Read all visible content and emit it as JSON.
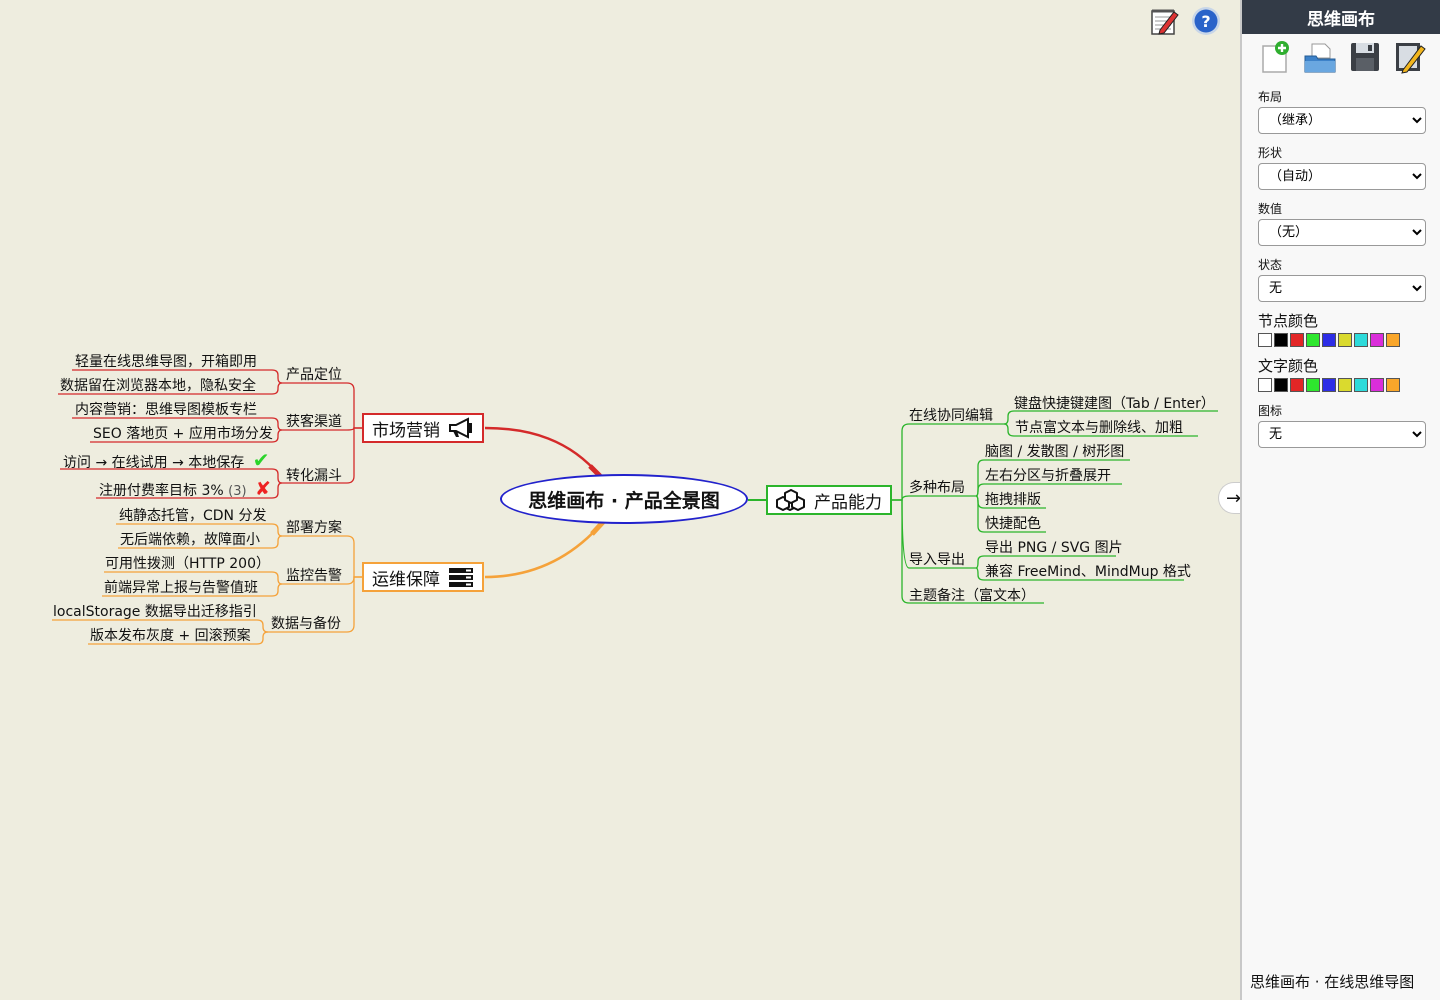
{
  "toolbar": {
    "edit_icon": "notepad-pencil-icon",
    "help_icon": "help-icon"
  },
  "map": {
    "root": "思维画布 · 产品全景图",
    "branches": {
      "marketing": {
        "label": "市场营销",
        "icon": "megaphone-icon",
        "color": "#d42a2a",
        "groups": [
          {
            "label": "产品定位",
            "items": [
              "轻量在线思维导图，开箱即用",
              "数据留在浏览器本地，隐私安全"
            ]
          },
          {
            "label": "获客渠道",
            "items": [
              "内容营销：思维导图模板专栏",
              "SEO 落地页 + 应用市场分发"
            ]
          },
          {
            "label": "转化漏斗",
            "items": [
              "访问 → 在线试用 → 本地保存",
              "注册付费率目标 3%"
            ],
            "count": "(3)"
          }
        ]
      },
      "ops": {
        "label": "运维保障",
        "icon": "server-icon",
        "color": "#f5a23a",
        "groups": [
          {
            "label": "部署方案",
            "items": [
              "纯静态托管，CDN 分发",
              "无后端依赖，故障面小"
            ]
          },
          {
            "label": "监控告警",
            "items": [
              "可用性拨测（HTTP 200）",
              "前端异常上报与告警值班"
            ]
          },
          {
            "label": "数据与备份",
            "items": [
              "localStorage 数据导出迁移指引",
              "版本发布灰度 + 回滚预案"
            ]
          }
        ]
      },
      "product": {
        "label": "产品能力",
        "icon": "cubes-icon",
        "color": "#2bb52b",
        "groups": [
          {
            "label": "在线协同编辑",
            "items": [
              "键盘快捷键建图（Tab / Enter）",
              "节点富文本与删除线、加粗"
            ]
          },
          {
            "label": "多种布局",
            "items": [
              "脑图 / 发散图 / 树形图",
              "左右分区与折叠展开",
              "拖拽排版",
              "快捷配色"
            ]
          },
          {
            "label": "导入导出",
            "items": [
              "导出 PNG / SVG 图片",
              "兼容 FreeMind、MindMup 格式"
            ]
          },
          {
            "label": "主题备注（富文本）",
            "items": []
          }
        ]
      }
    }
  },
  "panel": {
    "title": "思维画布",
    "tools": [
      "new-document-icon",
      "open-folder-icon",
      "save-disk-icon",
      "edit-document-icon"
    ],
    "layout_label": "布局",
    "layout_value": "（继承）",
    "shape_label": "形状",
    "shape_value": "（自动）",
    "value_label": "数值",
    "value_value": "（无）",
    "status_label": "状态",
    "status_value": "无",
    "node_color_label": "节点颜色",
    "text_color_label": "文字颜色",
    "icon_label": "图标",
    "icon_value": "无",
    "swatch_colors": [
      "#ffffff",
      "#000000",
      "#e22626",
      "#2ee62e",
      "#2e2ee6",
      "#dada2e",
      "#2edada",
      "#da2eda",
      "#f9a62a"
    ],
    "footer": "思维画布 · 在线思维导图"
  },
  "collapse_icon": "arrow-right-icon"
}
